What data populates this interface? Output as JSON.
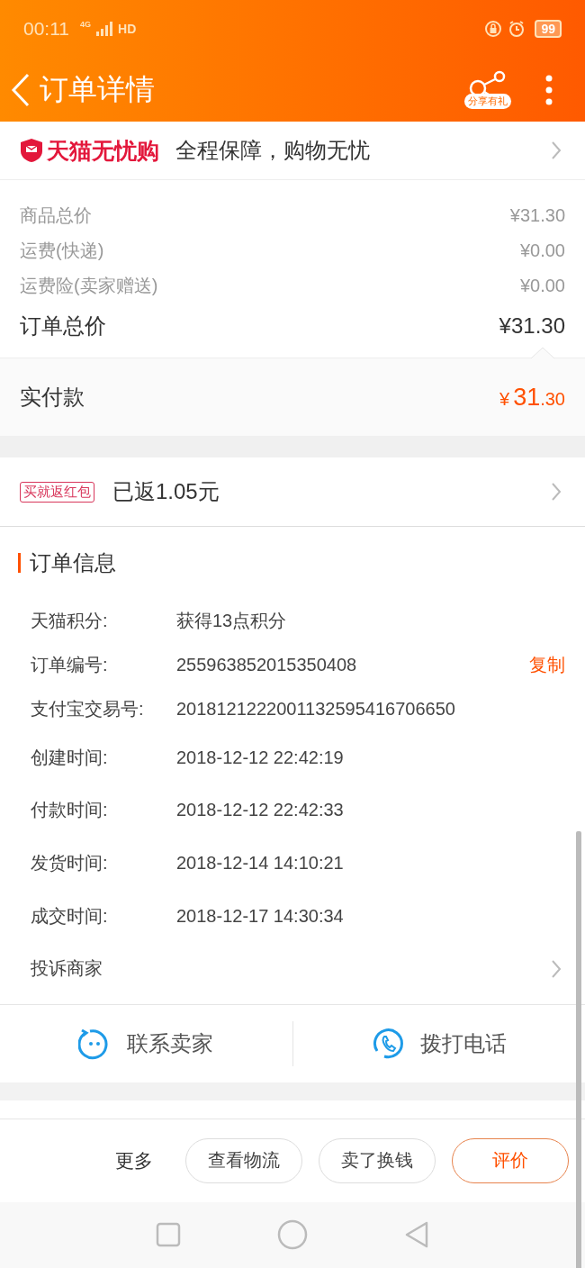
{
  "status_bar": {
    "time": "00:11",
    "network": "4G",
    "hd": "HD",
    "battery": "99"
  },
  "header": {
    "title": "订单详情",
    "share_label": "分享有礼"
  },
  "guarantee": {
    "brand": "天猫无忧购",
    "text": "全程保障，购物无忧"
  },
  "prices": [
    {
      "label": "商品总价",
      "value": "¥31.30",
      "kind": "minor"
    },
    {
      "label": "运费(快递)",
      "value": "¥0.00",
      "kind": "minor"
    },
    {
      "label": "运费险(卖家赠送)",
      "value": "¥0.00",
      "kind": "minor"
    },
    {
      "label": "订单总价",
      "value": "¥31.30",
      "kind": "total"
    }
  ],
  "paid": {
    "label": "实付款",
    "currency": "¥",
    "integer": "31",
    "decimal": ".30"
  },
  "red_packet": {
    "tag": "买就返红包",
    "text": "已返1.05元"
  },
  "order_info": {
    "title": "订单信息",
    "fields": [
      {
        "label": "天猫积分:",
        "value": "获得13点积分"
      },
      {
        "label": "订单编号:",
        "value": "255963852015350408",
        "action": "复制"
      },
      {
        "label": "支付宝交易号:",
        "value": "2018121222001132595416706650"
      },
      {
        "label": "创建时间:",
        "value": "2018-12-12 22:42:19"
      },
      {
        "label": "付款时间:",
        "value": "2018-12-12 22:42:33"
      },
      {
        "label": "发货时间:",
        "value": "2018-12-14 14:10:21"
      },
      {
        "label": "成交时间:",
        "value": "2018-12-17 14:30:34"
      }
    ],
    "complaint": "投诉商家"
  },
  "contact": [
    {
      "label": "联系卖家",
      "kind": "chat"
    },
    {
      "label": "拨打电话",
      "kind": "phone"
    }
  ],
  "actions": {
    "more": "更多",
    "buttons": [
      {
        "label": "查看物流",
        "primary": false
      },
      {
        "label": "卖了换钱",
        "primary": false
      },
      {
        "label": "评价",
        "primary": true
      }
    ]
  }
}
